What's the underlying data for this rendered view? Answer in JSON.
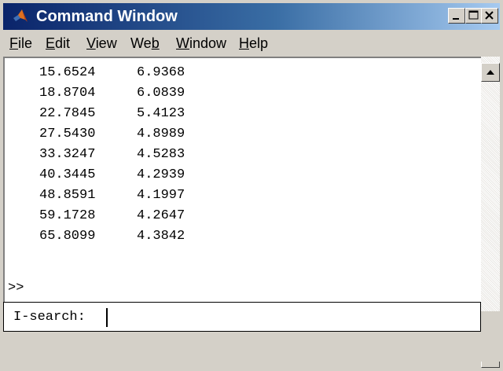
{
  "window": {
    "title": "Command Window",
    "icon": "matlab-logo-icon",
    "controls": [
      "minimize-icon",
      "maximize-icon",
      "close-icon"
    ]
  },
  "menu": {
    "items": [
      {
        "label": "File",
        "mnemonic": "F"
      },
      {
        "label": "Edit",
        "mnemonic": "E"
      },
      {
        "label": "View",
        "mnemonic": "V"
      },
      {
        "label": "Web",
        "mnemonic": "b"
      },
      {
        "label": "Window",
        "mnemonic": "W"
      },
      {
        "label": "Help",
        "mnemonic": "H"
      }
    ]
  },
  "output": {
    "rows": [
      {
        "a": "15.6524",
        "b": "6.9368"
      },
      {
        "a": "18.8704",
        "b": "6.0839"
      },
      {
        "a": "22.7845",
        "b": "5.4123"
      },
      {
        "a": "27.5430",
        "b": "4.8989"
      },
      {
        "a": "33.3247",
        "b": "4.5283"
      },
      {
        "a": "40.3445",
        "b": "4.2939"
      },
      {
        "a": "48.8591",
        "b": "4.1997"
      },
      {
        "a": "59.1728",
        "b": "4.2647"
      },
      {
        "a": "65.8099",
        "b": "4.3842"
      }
    ],
    "prompt": ">>"
  },
  "isearch": {
    "label": "I-search:",
    "value": ""
  },
  "colors": {
    "title_start": "#0a246a",
    "title_end": "#a6caf0",
    "face": "#d4d0c8",
    "pane": "#ffffff"
  }
}
